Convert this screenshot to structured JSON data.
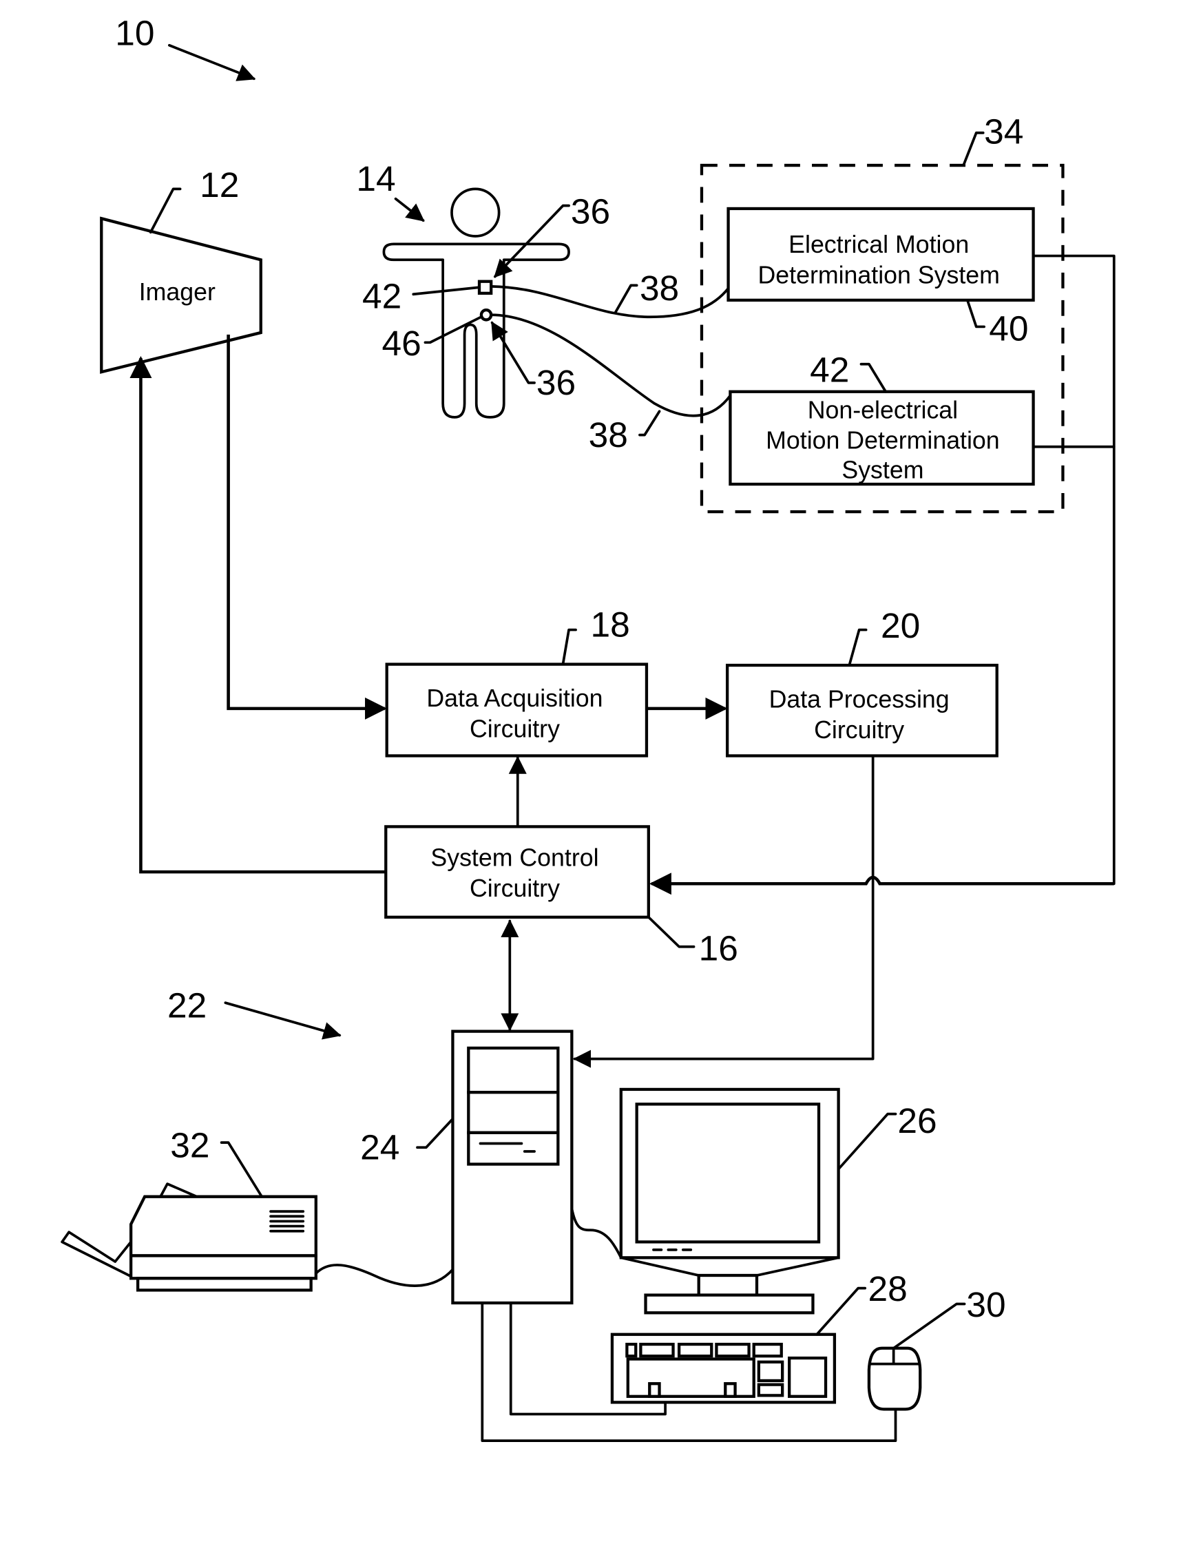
{
  "figure": {
    "system_ref": "10",
    "components": {
      "imager": {
        "ref": "12",
        "label": "Imager"
      },
      "patient": {
        "ref": "14"
      },
      "system_control": {
        "ref": "16",
        "line1": "System Control",
        "line2": "Circuitry"
      },
      "data_acquisition": {
        "ref": "18",
        "line1": "Data Acquisition",
        "line2": "Circuitry"
      },
      "data_processing": {
        "ref": "20",
        "line1": "Data Processing",
        "line2": "Circuitry"
      },
      "workstation": {
        "ref": "22"
      },
      "computer": {
        "ref": "24"
      },
      "monitor": {
        "ref": "26"
      },
      "keyboard": {
        "ref": "28"
      },
      "mouse": {
        "ref": "30"
      },
      "printer": {
        "ref": "32"
      },
      "motion_group": {
        "ref": "34"
      },
      "electrical_motion": {
        "ref": "40",
        "line1": "Electrical Motion",
        "line2": "Determination System"
      },
      "non_electrical_motion": {
        "ref": "42",
        "line1": "Non-electrical",
        "line2": "Motion Determination",
        "line3": "System"
      }
    },
    "sensors": {
      "sensor_top_ref": "36",
      "sensor_bottom_ref": "36",
      "square_sensor_ref": "42",
      "round_sensor_ref": "46",
      "lead_top_ref": "38",
      "lead_bottom_ref": "38"
    }
  }
}
